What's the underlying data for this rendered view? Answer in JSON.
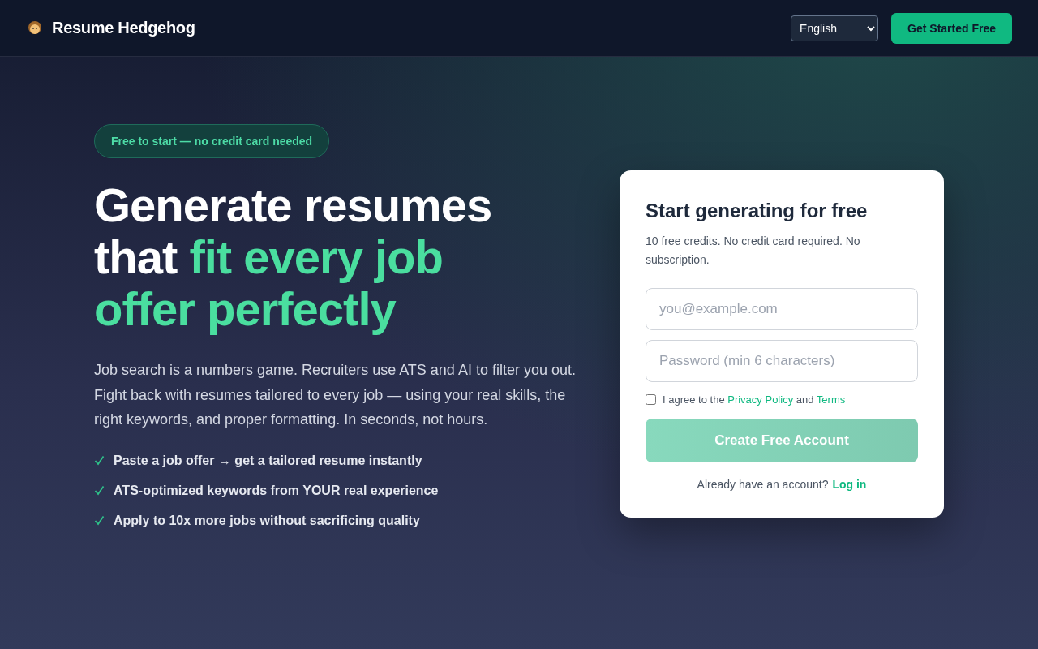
{
  "header": {
    "brand": "Resume Hedgehog",
    "language": {
      "value": "English"
    },
    "cta": "Get Started Free"
  },
  "hero": {
    "badge": "Free to start — no credit card needed",
    "headline": {
      "lead": "Generate resumes that",
      "accent": "fit every job offer perfectly"
    },
    "description": "Job search is a numbers game. Recruiters use ATS and AI to filter you out. Fight back with resumes tailored to every job — using your real skills, the right keywords, and proper formatting. In seconds, not hours.",
    "features": [
      {
        "text": "Paste a job offer → get a tailored resume instantly"
      },
      {
        "text": "ATS-optimized keywords from YOUR real experience"
      },
      {
        "text": "Apply to 10x more jobs without sacrificing quality"
      }
    ]
  },
  "signup": {
    "title": "Start generating for free",
    "subtitle": "10 free credits. No credit card required. No subscription.",
    "email": {
      "placeholder": "you@example.com"
    },
    "password": {
      "placeholder": "Password (min 6 characters)"
    },
    "consent": {
      "checked": false,
      "before": "I agree to the",
      "privacy_link": "Privacy Policy",
      "middle": "and",
      "terms_link": "Terms"
    },
    "submit": {
      "label": "Create Free Account",
      "disabled": true
    },
    "login_prompt": "Already have an account?",
    "login_link": "Log in"
  }
}
